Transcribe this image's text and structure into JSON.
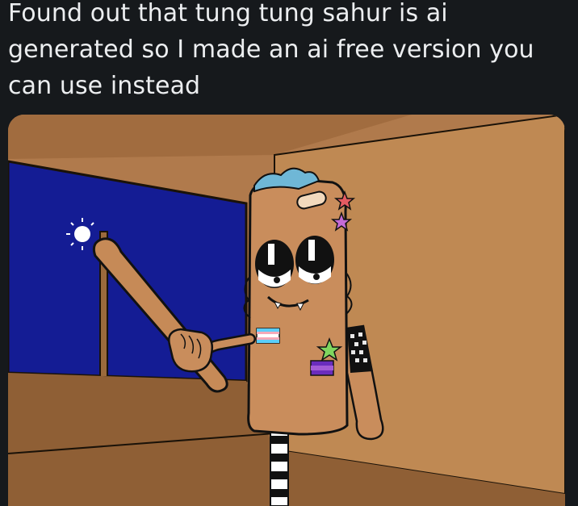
{
  "post": {
    "caption": "Found out that tung tung sahur is ai\ngenerated so I made an ai free version you\ncan use instead"
  },
  "image": {
    "subject": "tung-tung-sahur-drawing",
    "colors": {
      "background": "#16191c",
      "caption_text": "#eceef0",
      "room_wall": "#b8824f",
      "floor": "#946338",
      "night_sky": "#131c93",
      "character_body": "#c98d5c",
      "outline": "#111111"
    }
  }
}
